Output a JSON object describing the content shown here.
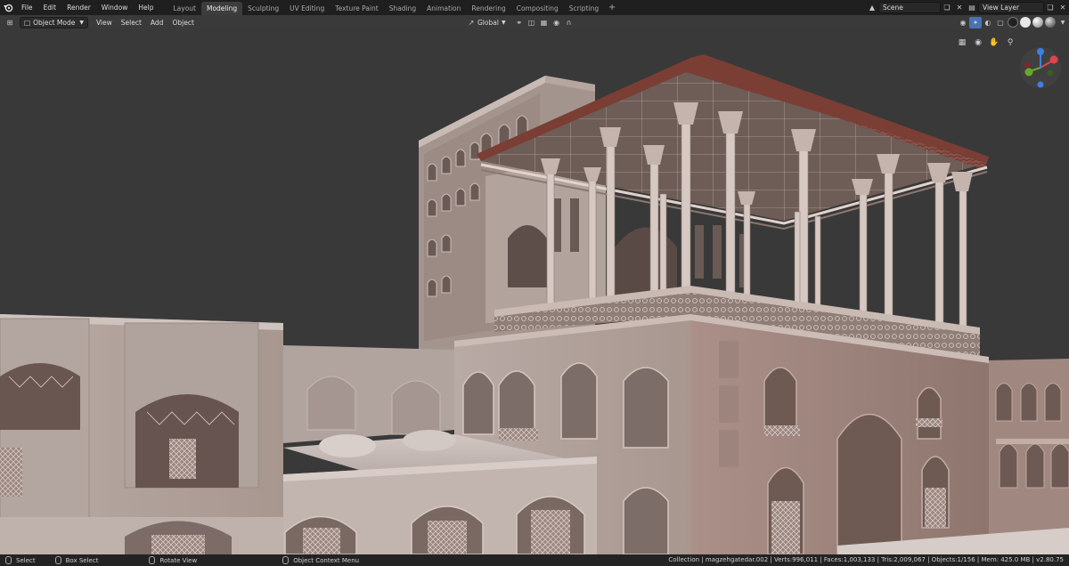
{
  "topbar": {
    "menus": [
      "File",
      "Edit",
      "Render",
      "Window",
      "Help"
    ],
    "workspaces": [
      "Layout",
      "Modeling",
      "Sculpting",
      "UV Editing",
      "Texture Paint",
      "Shading",
      "Animation",
      "Rendering",
      "Compositing",
      "Scripting"
    ],
    "active_workspace": "Modeling",
    "add_tab": "+",
    "scene_name": "Scene",
    "view_layer": "View Layer"
  },
  "header": {
    "mode": "Object Mode",
    "menus": [
      "View",
      "Select",
      "Add",
      "Object"
    ],
    "orientation": "Global"
  },
  "status": {
    "select": "Select",
    "box_select": "Box Select",
    "rotate_view": "Rotate View",
    "context_menu": "Object Context Menu",
    "stats": "Collection | magzehgatedar.002 | Verts:996,011 | Faces:1,003,133 | Tris:2,009,067 | Objects:1/156 | Mem: 425.0 MB | v2.80.75"
  },
  "icons": {
    "logo": "blender-logo-icon",
    "gizmo": "navigation-gizmo-icon"
  },
  "colors": {
    "accent": "#4772b3",
    "axis_x": "#e0454b",
    "axis_y": "#6aa82c",
    "axis_z": "#3f7fe0"
  }
}
